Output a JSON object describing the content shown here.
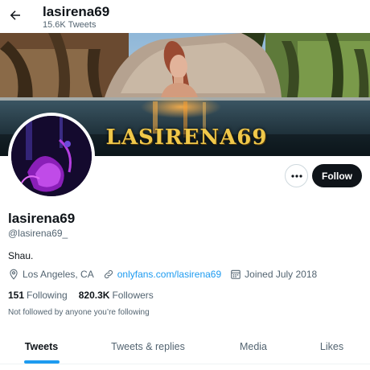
{
  "header": {
    "title": "lasirena69",
    "tweet_count": "15.6K Tweets"
  },
  "banner": {
    "watermark": "LASIRENA69"
  },
  "actions": {
    "follow_label": "Follow"
  },
  "profile": {
    "display_name": "lasirena69",
    "handle": "@lasirena69_",
    "bio": "Shau.",
    "location": "Los Angeles, CA",
    "website": "onlyfans.com/lasirena69",
    "joined": "Joined July 2018",
    "following_count": "151",
    "following_label": "Following",
    "followers_count": "820.3K",
    "followers_label": "Followers",
    "not_followed_note": "Not followed by anyone you’re following"
  },
  "tabs": [
    {
      "label": "Tweets",
      "active": true
    },
    {
      "label": "Tweets & replies",
      "active": false
    },
    {
      "label": "Media",
      "active": false
    },
    {
      "label": "Likes",
      "active": false
    }
  ],
  "colors": {
    "accent": "#1d9bf0",
    "text_primary": "#0f1419",
    "text_secondary": "#536471",
    "button_dark": "#0f1419"
  }
}
